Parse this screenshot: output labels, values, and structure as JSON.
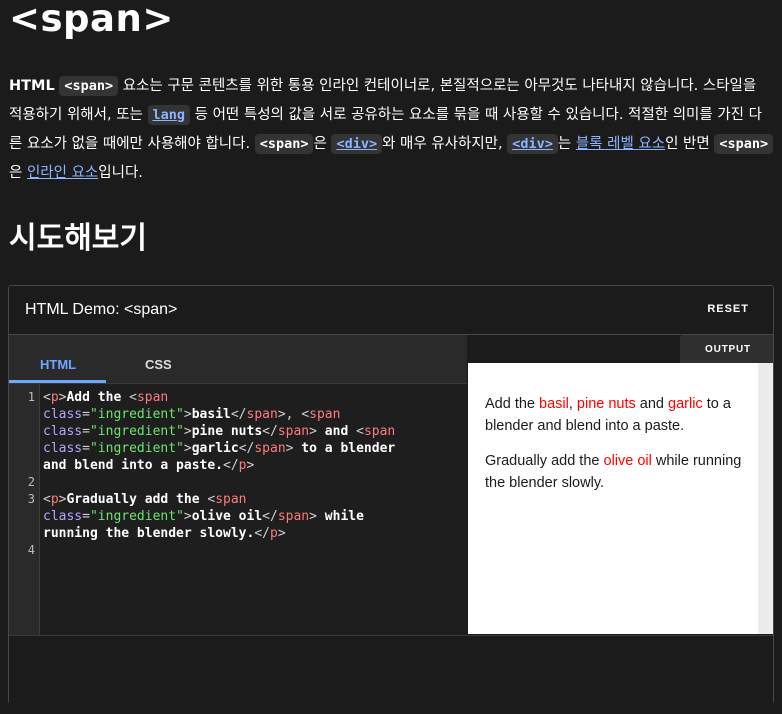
{
  "header": {
    "title": "<span>"
  },
  "intro": {
    "t1": "HTML",
    "c_span": "<span>",
    "t2": " 요소는 구문 콘텐츠를 위한 통용 인라인 컨테이너로, 본질적으로는 아무것도 나타내지 않습니다. 스타일을 적용하기 위해서, 또는 ",
    "link_lang": "lang",
    "t3": " 등 어떤 특성의 값을 서로 공유하는 요소를 묶을 때 사용할 수 있습니다. 적절한 의미를 가진 다른 요소가 없을 때에만 사용해야 합니다. ",
    "c_span2": "<span>",
    "t4": "은 ",
    "link_div": "<div>",
    "t5": "와 매우 유사하지만, ",
    "link_div2": "<div>",
    "t6": "는 ",
    "link_block": "블록 레벨 요소",
    "t7": "인 반면 ",
    "c_span3": "<span>",
    "t8": "은 ",
    "link_inline": "인라인 요소",
    "t9": "입니다."
  },
  "section": {
    "title": "시도해보기"
  },
  "demo": {
    "title": "HTML Demo: <span>",
    "reset_label": "RESET",
    "tabs": [
      {
        "label": "HTML"
      },
      {
        "label": "CSS"
      }
    ],
    "output_label": "OUTPUT",
    "line_numbers": [
      "1",
      "2",
      "3",
      "4"
    ],
    "code": {
      "r1": [
        "<",
        "p",
        ">",
        "Add the ",
        "<",
        "span"
      ],
      "r2": [
        "class",
        "=",
        "\"ingredient\"",
        ">",
        "basil",
        "</",
        "span",
        ">",
        ", ",
        "<",
        "span"
      ],
      "r3": [
        "class",
        "=",
        "\"ingredient\"",
        ">",
        "pine nuts",
        "</",
        "span",
        ">",
        " and ",
        "<",
        "span"
      ],
      "r4": [
        "class",
        "=",
        "\"ingredient\"",
        ">",
        "garlic",
        "</",
        "span",
        ">",
        " to a blender"
      ],
      "r5": [
        "and blend into a paste.",
        "</",
        "p",
        ">"
      ],
      "r7": [
        "<",
        "p",
        ">",
        "Gradually add the ",
        "<",
        "span"
      ],
      "r8": [
        "class",
        "=",
        "\"ingredient\"",
        ">",
        "olive oil",
        "</",
        "span",
        ">",
        " while"
      ],
      "r9": [
        "running the blender slowly.",
        "</",
        "p",
        ">"
      ]
    },
    "output": {
      "p1": {
        "a": "Add the ",
        "basil": "basil",
        "b": ", ",
        "pine": "pine nuts",
        "c": " and ",
        "garlic": "garlic",
        "d": " to a blender and blend into a paste."
      },
      "p2": {
        "a": "Gradually add the ",
        "oil": "olive oil",
        "b": " while running the blender slowly."
      }
    }
  }
}
